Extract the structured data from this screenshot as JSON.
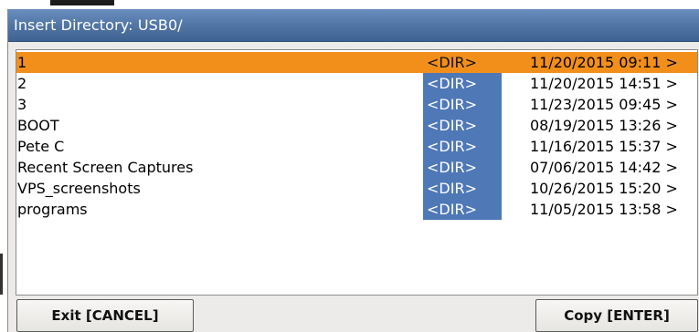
{
  "dialog": {
    "title": "Insert Directory: USB0/"
  },
  "file_list": {
    "selected_index": 0,
    "rows": [
      {
        "name": "1",
        "type": "<DIR>",
        "date": "11/20/2015 09:11 >"
      },
      {
        "name": "2",
        "type": "<DIR>",
        "date": "11/20/2015 14:51 >"
      },
      {
        "name": "3",
        "type": "<DIR>",
        "date": "11/23/2015 09:45 >"
      },
      {
        "name": "BOOT",
        "type": "<DIR>",
        "date": "08/19/2015 13:26 >"
      },
      {
        "name": "Pete C",
        "type": "<DIR>",
        "date": "11/16/2015 15:37 >"
      },
      {
        "name": "Recent Screen Captures",
        "type": "<DIR>",
        "date": "07/06/2015 14:42 >"
      },
      {
        "name": "VPS_screenshots",
        "type": "<DIR>",
        "date": "10/26/2015 15:20 >"
      },
      {
        "name": "programs",
        "type": "<DIR>",
        "date": "11/05/2015 13:58 >"
      }
    ]
  },
  "buttons": {
    "exit_label": "Exit [CANCEL]",
    "copy_label": "Copy [ENTER]"
  },
  "colors": {
    "title_bar": "#4f74a4",
    "selected_row": "#f28f1b",
    "dir_column": "#4f78b7"
  }
}
